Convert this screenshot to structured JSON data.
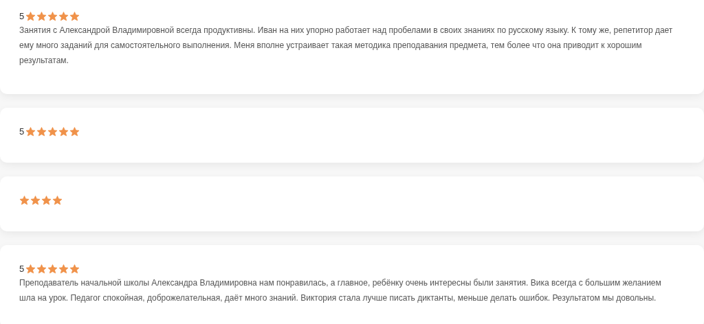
{
  "reviews": [
    {
      "rating": "5",
      "stars": 5,
      "text": "Занятия с Александрой Владимировной всегда продуктивны. Иван на них упорно работает над пробелами в своих знаниях по русскому языку. К тому же, репетитор дает ему много заданий для самостоятельного выполнения. Меня вполне устраивает такая методика преподавания предмета, тем более что она приводит к хорошим результатам."
    },
    {
      "rating": "5",
      "stars": 5
    },
    {
      "stars": 4
    },
    {
      "rating": "5",
      "stars": 5,
      "text": "Преподаватель начальной школы Александра Владимировна нам понравилась, а главное, ребёнку очень интересны были занятия. Вика всегда с большим желанием шла на урок. Педагог спокойная, доброжелательная, даёт много знаний. Виктория стала лучше писать диктанты, меньше делать ошибок. Результатом мы довольны."
    }
  ]
}
